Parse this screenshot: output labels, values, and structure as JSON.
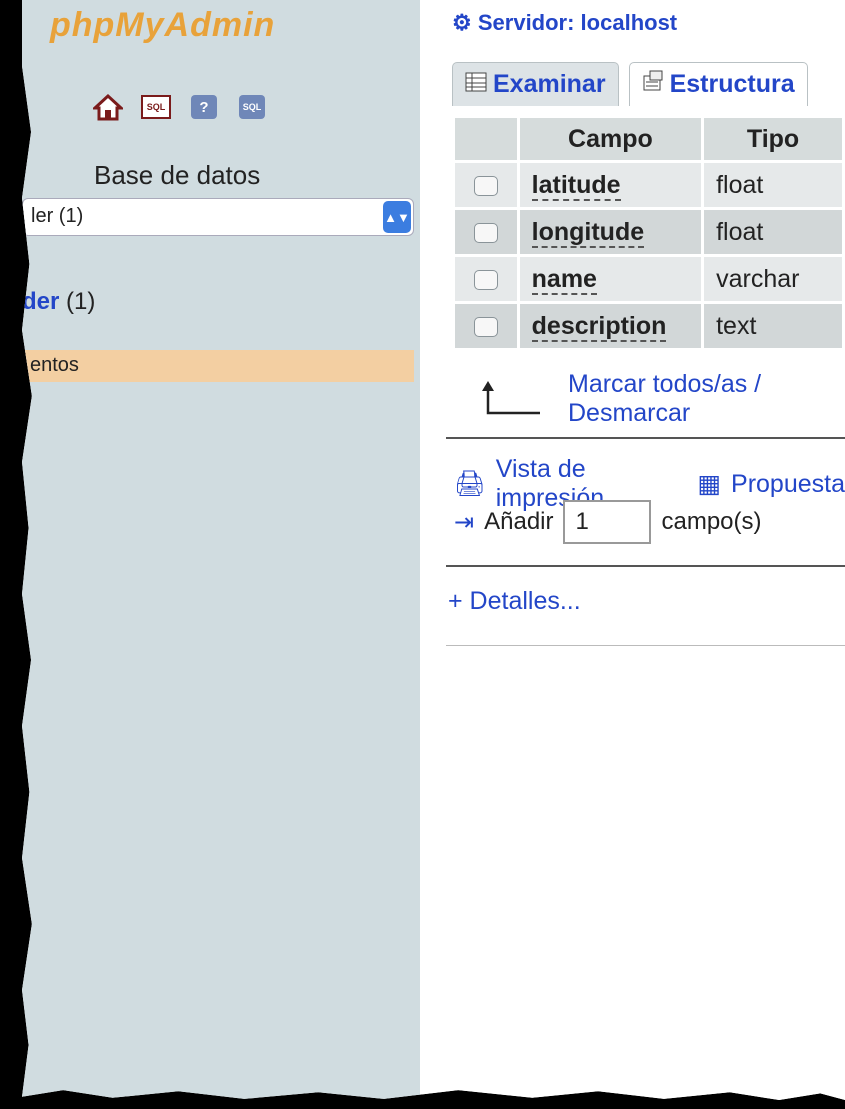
{
  "sidebar": {
    "logo_text": "phpMyAdmin",
    "icons": [
      "home-icon",
      "sql-query-icon",
      "help-icon",
      "sql-docs-icon"
    ],
    "sql_icon_label": "SQL",
    "help_icon_label": "?",
    "sqldoc_icon_label": "SQL",
    "db_label": "Base de datos",
    "db_select_value": "ler (1)",
    "db_name": "der",
    "db_count": "(1)",
    "table_item": "entos"
  },
  "main": {
    "server_crumb": "Servidor: localhost",
    "tabs": [
      {
        "label": "Examinar",
        "icon": "table-icon"
      },
      {
        "label": "Estructura",
        "icon": "structure-icon"
      }
    ],
    "table": {
      "headers": [
        "Campo",
        "Tipo"
      ],
      "rows": [
        {
          "field": "latitude",
          "type": "float"
        },
        {
          "field": "longitude",
          "type": "float"
        },
        {
          "field": "name",
          "type": "varchar"
        },
        {
          "field": "description",
          "type": "text"
        }
      ]
    },
    "mark_all": "Marcar todos/as / Desmarcar",
    "print_view": "Vista de impresión",
    "propose": "Propuesta",
    "add_label": "Añadir",
    "add_value": "1",
    "fields_suffix": "campo(s)",
    "details": "+ Detalles..."
  }
}
